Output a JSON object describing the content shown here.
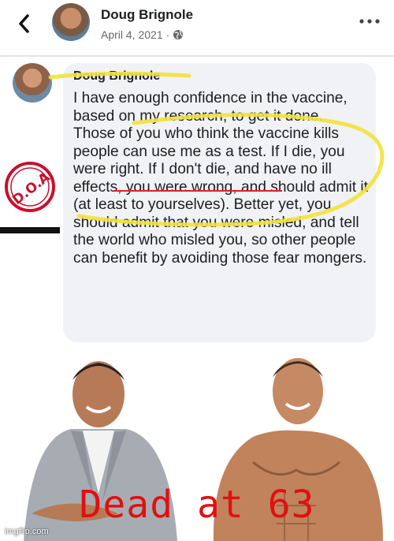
{
  "header": {
    "name": "Doug Brignole",
    "date": "April 4, 2021",
    "separator": "·"
  },
  "comment": {
    "name": "Doug Brignole",
    "text": "I have enough confidence in the vaccine, based on my research, to get it done. Those of you who think the vaccine kills people can use me as a test. If I die, you were right. If I don't die, and have no ill effects, you were wrong, and should admit it (at least to yourselves). Better yet, you should admit that you were misled, and tell the world who misled you, so other people can benefit by avoiding those fear mongers."
  },
  "stamp": {
    "text": "D.O.A"
  },
  "caption": "Dead at 63",
  "watermark": "imgflip.com",
  "colors": {
    "highlight": "#f2e23a",
    "underline": "#e02020",
    "caption": "#e01010",
    "bubble": "#f0f2f5"
  },
  "icons": [
    "back-chevron-icon",
    "globe-icon",
    "more-options-icon"
  ]
}
